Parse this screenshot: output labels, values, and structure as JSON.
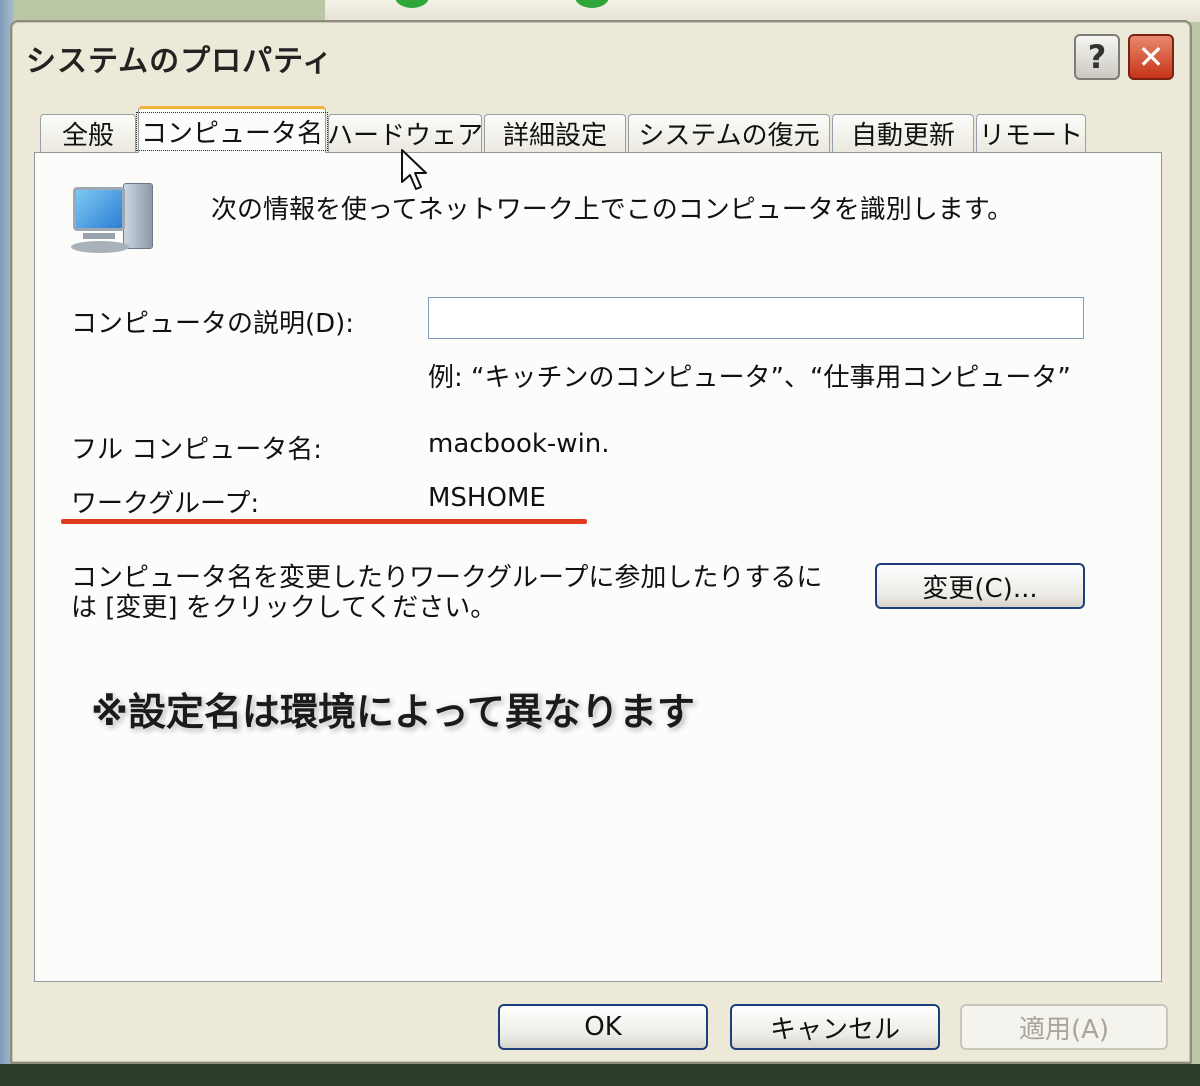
{
  "window": {
    "title": "システムのプロパティ",
    "help_label": "?",
    "close_label": "✕"
  },
  "tabs": [
    {
      "label": "全般"
    },
    {
      "label": "コンピュータ名",
      "active": true
    },
    {
      "label": "ハードウェア"
    },
    {
      "label": "詳細設定"
    },
    {
      "label": "システムの復元"
    },
    {
      "label": "自動更新"
    },
    {
      "label": "リモート"
    }
  ],
  "computer_name": {
    "intro": "次の情報を使ってネットワーク上でこのコンピュータを識別します。",
    "description_label": "コンピュータの説明(D):",
    "description_value": "",
    "example": "例: “キッチンのコンピュータ”、“仕事用コンピュータ”",
    "full_name_label": "フル コンピュータ名:",
    "full_name_value": "macbook-win.",
    "workgroup_label": "ワークグループ:",
    "workgroup_value": "MSHOME",
    "change_text": "コンピュータ名を変更したりワークグループに参加したりするには [変更] をクリックしてください。",
    "change_button": "変更(C)..."
  },
  "annotation": {
    "note": "※設定名は環境によって異なります",
    "underline_color": "#e23a1c"
  },
  "buttons": {
    "ok": "OK",
    "cancel": "キャンセル",
    "apply": "適用(A)"
  },
  "icons": {
    "computer": "computer-icon",
    "cursor": "mouse-cursor-icon"
  }
}
